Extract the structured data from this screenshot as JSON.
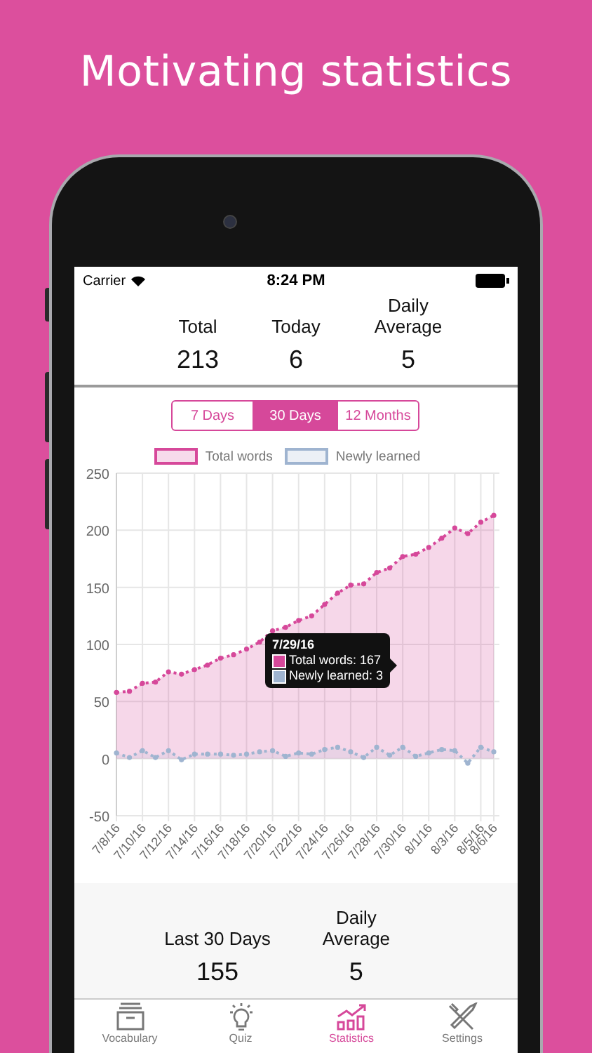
{
  "headline": "Motivating statistics",
  "status_bar": {
    "carrier": "Carrier",
    "time": "8:24 PM"
  },
  "summary": [
    {
      "label": "Total",
      "value": "213"
    },
    {
      "label": "Today",
      "value": "6"
    },
    {
      "label": "Daily Average",
      "value": "5"
    }
  ],
  "range_tabs": [
    {
      "label": "7 Days",
      "selected": false
    },
    {
      "label": "30 Days",
      "selected": true
    },
    {
      "label": "12 Months",
      "selected": false
    }
  ],
  "chart": {
    "chart_data": {
      "type": "area",
      "grid": true,
      "categories": [
        "7/8/16",
        null,
        "7/10/16",
        null,
        "7/12/16",
        null,
        "7/14/16",
        null,
        "7/16/16",
        null,
        "7/18/16",
        null,
        "7/20/16",
        null,
        "7/22/16",
        null,
        "7/24/16",
        null,
        "7/26/16",
        null,
        "7/28/16",
        null,
        "7/30/16",
        null,
        "8/1/16",
        null,
        "8/3/16",
        null,
        "8/5/16",
        "8/6/16"
      ],
      "series": [
        {
          "name": "Total words",
          "color": "#d6489a",
          "values": [
            58,
            59,
            66,
            67,
            76,
            74,
            78,
            82,
            88,
            91,
            96,
            102,
            112,
            115,
            121,
            125,
            135,
            145,
            152,
            153,
            163,
            167,
            177,
            179,
            185,
            193,
            202,
            197,
            207,
            213
          ]
        },
        {
          "name": "Newly learned",
          "color": "#9fb4d0",
          "values": [
            5,
            1,
            7,
            1,
            7,
            -1,
            4,
            4,
            4,
            3,
            4,
            6,
            7,
            2,
            5,
            4,
            8,
            10,
            6,
            1,
            10,
            3,
            10,
            2,
            5,
            8,
            7,
            -4,
            10,
            6
          ]
        }
      ],
      "ylim": [
        -50,
        250
      ],
      "yticks": [
        -50,
        0,
        50,
        100,
        150,
        200,
        250
      ]
    },
    "tooltip": {
      "title": "7/29/16",
      "lines": [
        {
          "text": "Total words: 167",
          "color": "#d6489a"
        },
        {
          "text": "Newly learned: 3",
          "color": "#9fb4d0"
        }
      ]
    }
  },
  "period_summary": [
    {
      "label": "Last 30 Days",
      "value": "155"
    },
    {
      "label": "Daily Average",
      "value": "5"
    }
  ],
  "tab_bar": [
    {
      "label": "Vocabulary",
      "selected": false
    },
    {
      "label": "Quiz",
      "selected": false
    },
    {
      "label": "Statistics",
      "selected": true
    },
    {
      "label": "Settings",
      "selected": false
    }
  ]
}
